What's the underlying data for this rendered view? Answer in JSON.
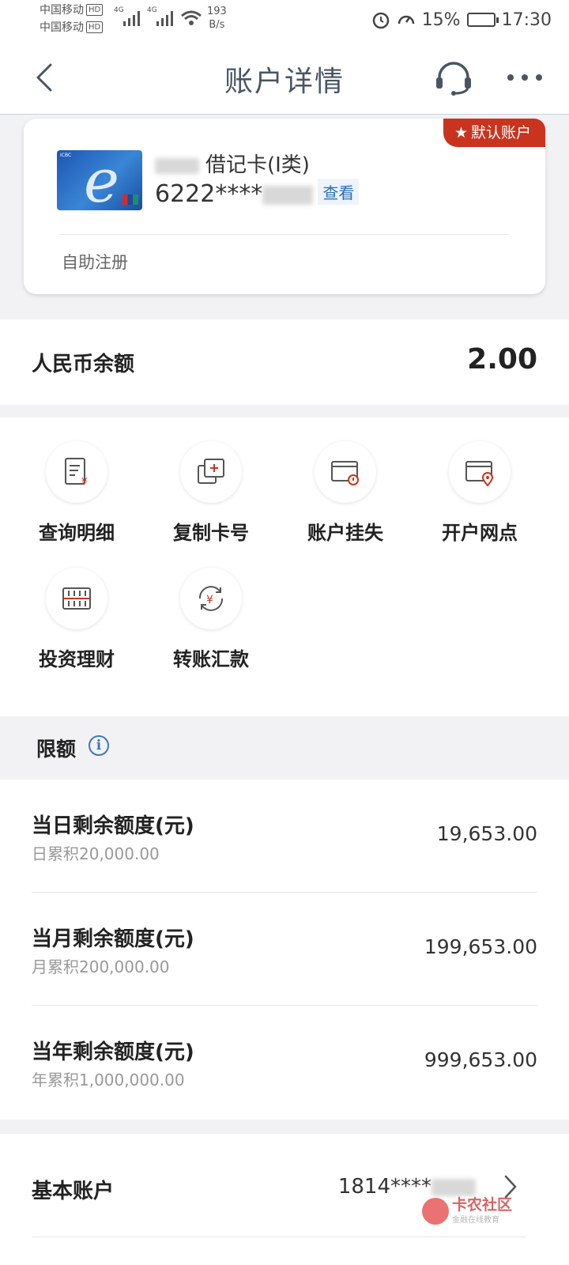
{
  "status_bar": {
    "carrier1": "中国移动",
    "carrier2": "中国移动",
    "hd": "HD",
    "network": "4G",
    "speed_value": "193",
    "speed_unit": "B/s",
    "battery": "15%",
    "time": "17:30"
  },
  "nav": {
    "title": "账户详情"
  },
  "card": {
    "default_tag": "默认账户",
    "card_type": "借记卡(I类)",
    "card_number_prefix": "6222****",
    "view_label": "查看",
    "footer": "自助注册"
  },
  "balance": {
    "label": "人民币余额",
    "amount": "2.00"
  },
  "actions": [
    {
      "label": "查询明细",
      "icon": "statement-icon"
    },
    {
      "label": "复制卡号",
      "icon": "copy-icon"
    },
    {
      "label": "账户挂失",
      "icon": "card-alert-icon"
    },
    {
      "label": "开户网点",
      "icon": "card-location-icon"
    },
    {
      "label": "投资理财",
      "icon": "abacus-icon"
    },
    {
      "label": "转账汇款",
      "icon": "transfer-icon"
    }
  ],
  "limits": {
    "title": "限额",
    "rows": [
      {
        "title": "当日剩余额度(元)",
        "sub": "日累积20,000.00",
        "value": "19,653.00"
      },
      {
        "title": "当月剩余额度(元)",
        "sub": "月累积200,000.00",
        "value": "199,653.00"
      },
      {
        "title": "当年剩余额度(元)",
        "sub": "年累积1,000,000.00",
        "value": "999,653.00"
      }
    ]
  },
  "base_account": {
    "label": "基本账户",
    "number_prefix": "1814****"
  },
  "watermark": {
    "title": "卡农社区",
    "subtitle": "金融在线教育"
  },
  "colors": {
    "accent_red": "#c8341e",
    "link_blue": "#2b6fb8"
  }
}
